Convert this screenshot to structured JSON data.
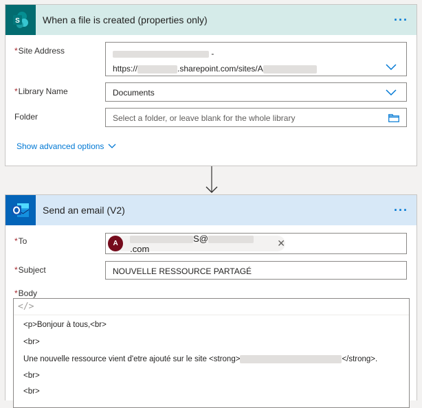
{
  "trigger": {
    "title": "When a file is created (properties only)",
    "more_icon": "ellipsis-icon",
    "site_address": {
      "label": "Site Address",
      "line1_suffix": "-",
      "line2_prefix": "https://",
      "line2_middle": ".sharepoint.com/sites/A"
    },
    "library_name": {
      "label": "Library Name",
      "value": "Documents"
    },
    "folder": {
      "label": "Folder",
      "placeholder": "Select a folder, or leave blank for the whole library"
    },
    "advanced_link": "Show advanced options"
  },
  "action": {
    "title": "Send an email (V2)",
    "more_icon": "ellipsis-icon",
    "to": {
      "label": "To",
      "avatar_initial": "A",
      "recipient_suffix": "S@",
      "recipient_domain_end": ".com",
      "remove": "✕"
    },
    "subject": {
      "label": "Subject",
      "value": "NOUVELLE RESSOURCE PARTAGÉ"
    },
    "body": {
      "label": "Body",
      "code_icon": "</>",
      "lines": [
        "<p>Bonjour à tous,<br>",
        "<br>",
        "Une nouvelle ressource vient d'etre ajouté sur le site <strong>",
        "</strong>.",
        "<br>",
        "<br>"
      ]
    }
  },
  "colors": {
    "sharepoint": "#036c70",
    "outlook": "#0364b8",
    "accent": "#0078d4",
    "required": "#a4262c"
  }
}
